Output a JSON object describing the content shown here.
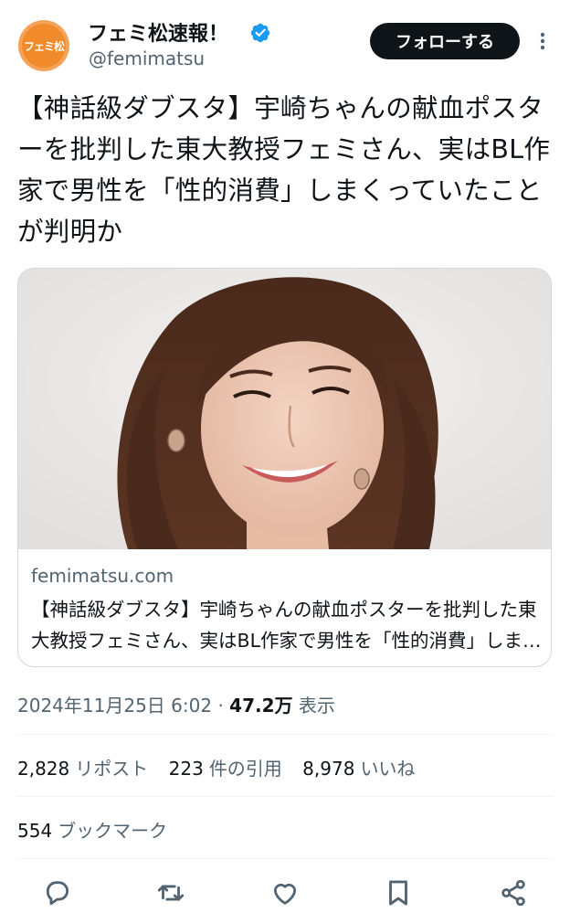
{
  "account": {
    "display_name": "フェミ松速報！",
    "handle": "@femimatsu",
    "avatar_text": "フェミ松",
    "verified_color": "#1d9bf0"
  },
  "follow_button": {
    "label": "フォローする"
  },
  "tweet": {
    "text": "【神話級ダブスタ】宇崎ちゃんの献血ポスターを批判した東大教授フェミさん、実はBL作家で男性を「性的消費」しまくっていたことが判明か"
  },
  "card": {
    "domain": "femimatsu.com",
    "title": "【神話級ダブスタ】宇崎ちゃんの献血ポスターを批判した東大教授フェミさん、実はBL作家で男性を「性的消費」しまくっていたことが判明か"
  },
  "meta": {
    "timestamp": "2024年11月25日 6:02",
    "separator": "·",
    "views_count": "47.2万",
    "views_label": "表示"
  },
  "stats": {
    "reposts_count": "2,828",
    "reposts_label": "リポスト",
    "quotes_count": "223",
    "quotes_label": "件の引用",
    "likes_count": "8,978",
    "likes_label": "いいね"
  },
  "bookmarks": {
    "count": "554",
    "label": "ブックマーク"
  },
  "actions": {
    "icons": [
      "reply-icon",
      "repost-icon",
      "like-icon",
      "bookmark-icon",
      "share-icon"
    ]
  },
  "colors": {
    "text": "#0f1419",
    "secondary": "#536471",
    "border": "#cfd9de",
    "accent": "#1d9bf0",
    "avatar": "#f08a2a"
  }
}
